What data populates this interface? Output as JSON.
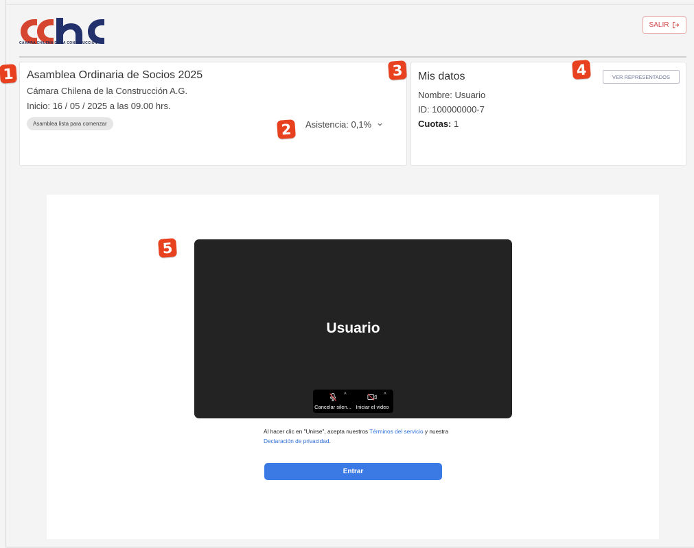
{
  "header": {
    "logo_text": "CChC",
    "logo_subtitle": "CÁMARA CHILENA DE LA CONSTRUCCIÓN",
    "logout_label": "SALIR"
  },
  "assembly": {
    "title": "Asamblea Ordinaria de Socios 2025",
    "organization": "Cámara Chilena de la Construcción A.G.",
    "start": "Inicio: 16 / 05 / 2025 a las 09.00 hrs.",
    "status": "Asamblea lista para comenzar",
    "attendance": "Asistencia: 0,1%"
  },
  "my_data": {
    "title": "Mis datos",
    "name": "Nombre: Usuario",
    "id": "ID: 100000000-7",
    "quotas_label": "Cuotas:",
    "quotas_value": "1",
    "represented_button": "VER REPRESENTADOS"
  },
  "markers": [
    "1",
    "2",
    "3",
    "4",
    "5"
  ],
  "zoom": {
    "participant_name": "Usuario",
    "mic_label": "Cancelar silen...",
    "video_label": "Iniciar el video",
    "terms_before": "Al hacer clic en \"Unirse\", acepta nuestros ",
    "terms_link": "Términos del servicio",
    "terms_middle": " y nuestra ",
    "privacy_link": "Declaración de privacidad",
    "terms_end": ".",
    "enter_button": "Entrar"
  },
  "colors": {
    "brand_red": "#d34848",
    "brand_navy": "#1d2a55",
    "marker": "#e8411f",
    "primary_button": "#3b79e4",
    "video_bg": "#232323"
  },
  "icons": [
    "logout-icon",
    "chevron-down-icon",
    "mic-muted-icon",
    "video-off-icon"
  ]
}
